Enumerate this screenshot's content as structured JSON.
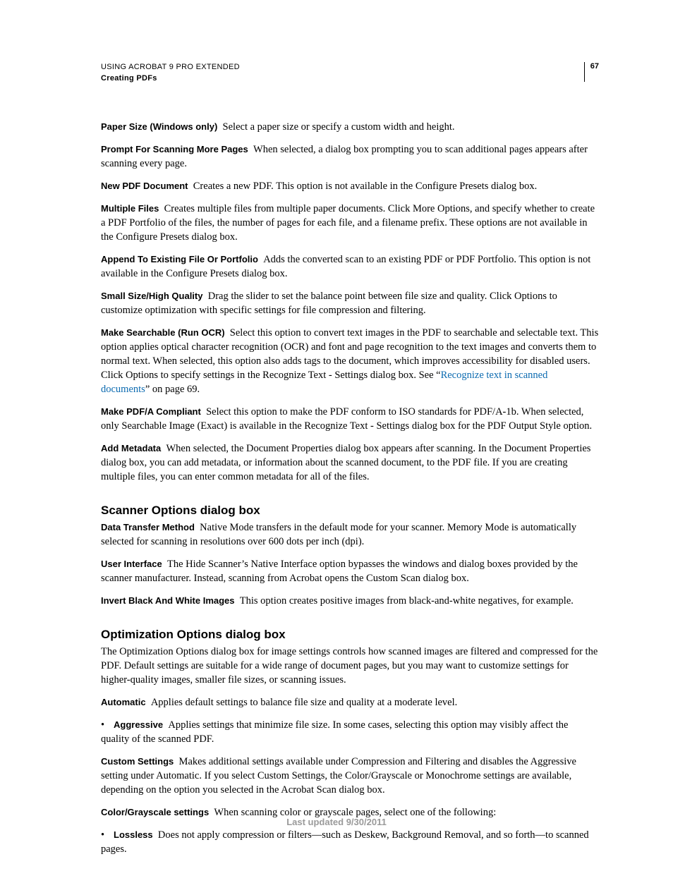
{
  "header": {
    "line1": "USING ACROBAT 9 PRO EXTENDED",
    "line2": "Creating PDFs",
    "page_number": "67"
  },
  "items": [
    {
      "term": "Paper Size (Windows only)",
      "desc": "Select a paper size or specify a custom width and height."
    },
    {
      "term": "Prompt For Scanning More Pages",
      "desc": "When selected, a dialog box prompting you to scan additional pages appears after scanning every page."
    },
    {
      "term": "New PDF Document",
      "desc": "Creates a new PDF. This option is not available in the Configure Presets dialog box."
    },
    {
      "term": "Multiple Files",
      "desc": "Creates multiple files from multiple paper documents. Click More Options, and specify whether to create a PDF Portfolio of the files, the number of pages for each file, and a filename prefix. These options are not available in the Configure Presets dialog box."
    },
    {
      "term": "Append To Existing File Or Portfolio",
      "desc": "Adds the converted scan to an existing PDF or PDF Portfolio. This option is not available in the Configure Presets dialog box."
    },
    {
      "term": "Small Size/High Quality",
      "desc": "Drag the slider to set the balance point between file size and quality. Click Options to customize optimization with specific settings for file compression and filtering."
    }
  ],
  "make_searchable": {
    "term": "Make Searchable (Run OCR)",
    "desc_pre": "Select this option to convert text images in the PDF to searchable and selectable text. This option applies optical character recognition (OCR) and font and page recognition to the text images and converts them to normal text. When selected, this option also adds tags to the document, which improves accessibility for disabled users. Click Options to specify settings in the Recognize Text - Settings dialog box. See “",
    "link_text": "Recognize text in scanned documents",
    "desc_post": "” on page 69."
  },
  "items2": [
    {
      "term": "Make PDF/A Compliant",
      "desc": "Select this option to make the PDF conform to ISO standards for PDF/A-1b. When selected, only Searchable Image (Exact) is available in the Recognize Text - Settings dialog box for the PDF Output Style option."
    },
    {
      "term": "Add Metadata",
      "desc": "When selected, the Document Properties dialog box appears after scanning. In the Document Properties dialog box, you can add metadata, or information about the scanned document, to the PDF file. If you are creating multiple files, you can enter common metadata for all of the files."
    }
  ],
  "section1": {
    "heading": "Scanner Options dialog box",
    "items": [
      {
        "term": "Data Transfer Method",
        "desc": "Native Mode transfers in the default mode for your scanner. Memory Mode is automatically selected for scanning in resolutions over 600 dots per inch (dpi)."
      },
      {
        "term": "User Interface",
        "desc": "The Hide Scanner’s Native Interface option bypasses the windows and dialog boxes provided by the scanner manufacturer. Instead, scanning from Acrobat opens the Custom Scan dialog box."
      },
      {
        "term": "Invert Black And White Images",
        "desc": "This option creates positive images from black-and-white negatives, for example."
      }
    ]
  },
  "section2": {
    "heading": "Optimization Options dialog box",
    "intro": "The Optimization Options dialog box for image settings controls how scanned images are filtered and compressed for the PDF. Default settings are suitable for a wide range of document pages, but you may want to customize settings for higher-quality images, smaller file sizes, or scanning issues.",
    "items": [
      {
        "term": "Automatic",
        "desc": "Applies default settings to balance file size and quality at a moderate level."
      }
    ],
    "bullet1": {
      "term": "Aggressive",
      "desc": "Applies settings that minimize file size. In some cases, selecting this option may visibly affect the quality of the scanned PDF."
    },
    "items2": [
      {
        "term": "Custom Settings",
        "desc": "Makes additional settings available under Compression and Filtering and disables the Aggressive setting under Automatic. If you select Custom Settings, the Color/Grayscale or Monochrome settings are available, depending on the option you selected in the Acrobat Scan dialog box."
      },
      {
        "term": "Color/Grayscale settings",
        "desc": "When scanning color or grayscale pages, select one of the following:"
      }
    ],
    "bullet2": {
      "term": "Lossless",
      "desc": "Does not apply compression or filters—such as Deskew, Background Removal, and so forth—to scanned pages."
    }
  },
  "footer": "Last updated 9/30/2011"
}
